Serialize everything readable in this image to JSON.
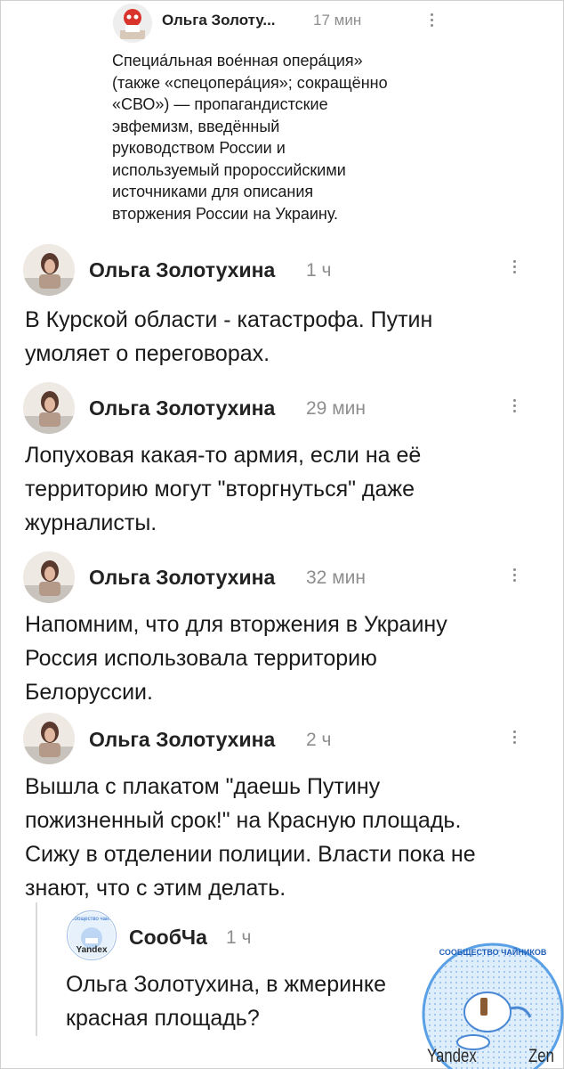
{
  "quoted_comment": {
    "author": "Ольга Золоту...",
    "time": "17 мин",
    "text": "Специа́льная вое́нная опера́ция»\n(также «спецопера́ция»; сокращённо\n«СВО») — пропагандистские\nэвфемизм, введённый\nруководством России и\nиспользуемый пророссийскими\nисточниками для описания\nвторжения России на Украину."
  },
  "comments": [
    {
      "author": "Ольга Золотухина",
      "time": "1 ч",
      "text": "В Курской области - катастрофа. Путин\nумоляет о переговорах."
    },
    {
      "author": "Ольга Золотухина",
      "time": "29 мин",
      "text": "Лопуховая какая-то армия, если на её\nтерриторию могут \"вторгнуться\" даже\nжурналисты."
    },
    {
      "author": "Ольга Золотухина",
      "time": "32 мин",
      "text": "Напомним, что для вторжения в Украину\nРоссия использовала территорию\nБелоруссии."
    },
    {
      "author": "Ольга Золотухина",
      "time": "2 ч",
      "text": "Вышла с плакатом \"даешь Путину\nпожизненный срок!\" на Красную площадь.\nСижу в отделении полиции. Власти пока не\nзнают, что с этим делать."
    }
  ],
  "reply": {
    "author": "СообЧа",
    "time": "1 ч",
    "text": "Ольга Золотухина, в жмеринке\nкрасная площадь?",
    "avatar_text": "ообщество чайн",
    "avatar_brand": "Yandex"
  },
  "watermark": {
    "title": "СООБЩЕСТВО ЧАЙНИКОВ",
    "brand_left": "Yandex",
    "brand_right": "Zen"
  },
  "colors": {
    "accent_blue": "#2f6fd0",
    "time_gray": "#8e8e8e"
  }
}
